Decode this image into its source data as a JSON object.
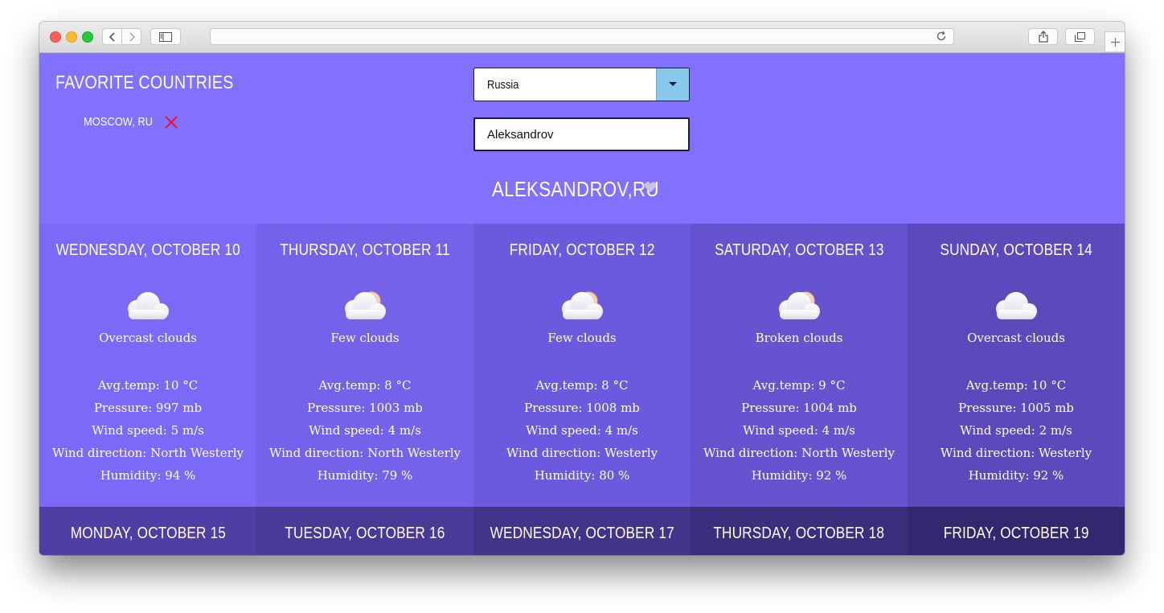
{
  "browser": {
    "address": ""
  },
  "favorites": {
    "title": "FAVORITE COUNTRIES",
    "items": [
      {
        "label": "MOSCOW, RU",
        "remove_icon": "close-icon",
        "remove_color": "#e5142a"
      }
    ]
  },
  "controls": {
    "country_value": "Russia",
    "city_value": "Aleksandrov",
    "dropdown_icon": "chevron-down-icon"
  },
  "location": {
    "title": "ALEKSANDROV,RU",
    "favorite_icon": "heart-icon"
  },
  "colors": {
    "header_bg": "#8270ff",
    "accent_select": "#88c8ea",
    "remove_icon": "#e5142a",
    "heart": "#c7c2e6"
  },
  "forecast": [
    {
      "day": "WEDNESDAY, OCTOBER 10",
      "icon": "overcast-clouds-icon",
      "description": "Overcast clouds",
      "avg_temp": "Avg.temp: 10 °C",
      "pressure": "Pressure: 997 mb",
      "wind_speed": "Wind speed: 5 m/s",
      "wind_direction": "Wind direction: North Westerly",
      "humidity": "Humidity: 94 %"
    },
    {
      "day": "THURSDAY, OCTOBER 11",
      "icon": "few-clouds-icon",
      "description": "Few clouds",
      "avg_temp": "Avg.temp: 8 °C",
      "pressure": "Pressure: 1003 mb",
      "wind_speed": "Wind speed: 4 m/s",
      "wind_direction": "Wind direction: North Westerly",
      "humidity": "Humidity: 79 %"
    },
    {
      "day": "FRIDAY, OCTOBER 12",
      "icon": "few-clouds-icon",
      "description": "Few clouds",
      "avg_temp": "Avg.temp: 8 °C",
      "pressure": "Pressure: 1008 mb",
      "wind_speed": "Wind speed: 4 m/s",
      "wind_direction": "Wind direction: Westerly",
      "humidity": "Humidity: 80 %"
    },
    {
      "day": "SATURDAY, OCTOBER 13",
      "icon": "broken-clouds-icon",
      "description": "Broken clouds",
      "avg_temp": "Avg.temp: 9 °C",
      "pressure": "Pressure: 1004 mb",
      "wind_speed": "Wind speed: 4 m/s",
      "wind_direction": "Wind direction: North Westerly",
      "humidity": "Humidity: 92 %"
    },
    {
      "day": "SUNDAY, OCTOBER 14",
      "icon": "overcast-clouds-icon",
      "description": "Overcast clouds",
      "avg_temp": "Avg.temp: 10 °C",
      "pressure": "Pressure: 1005 mb",
      "wind_speed": "Wind speed: 2 m/s",
      "wind_direction": "Wind direction: Westerly",
      "humidity": "Humidity: 92 %"
    }
  ],
  "forecast_next": [
    {
      "day": "MONDAY, OCTOBER 15"
    },
    {
      "day": "TUESDAY, OCTOBER 16"
    },
    {
      "day": "WEDNESDAY, OCTOBER 17"
    },
    {
      "day": "THURSDAY, OCTOBER 18"
    },
    {
      "day": "FRIDAY, OCTOBER 19"
    }
  ]
}
